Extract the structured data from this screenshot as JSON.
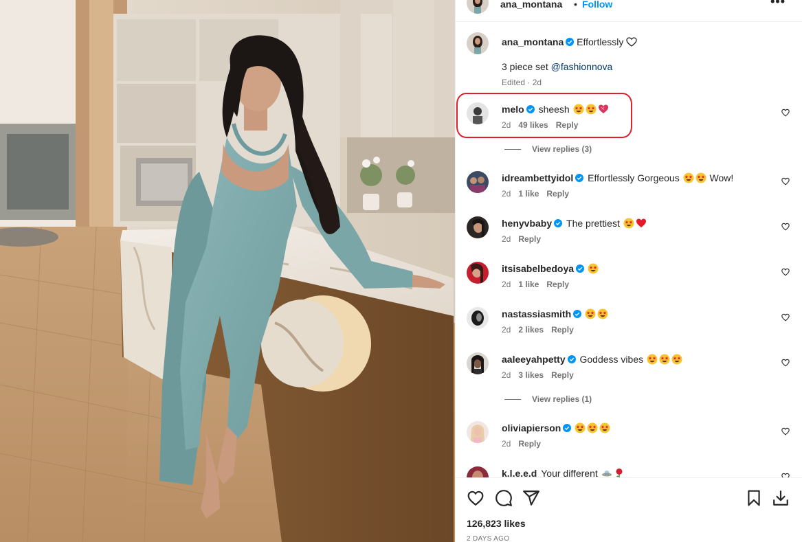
{
  "post": {
    "author": "ana_montana",
    "separator": "•",
    "follow_label": "Follow",
    "more_label": "•••",
    "caption_line1": "Effortlessly",
    "caption_line2_prefix": "3 piece set",
    "caption_mention": "@fashionnova",
    "caption_meta": "Edited · 2d",
    "likes": "126,823 likes",
    "date": "2 DAYS AGO"
  },
  "comments": [
    {
      "user": "melo",
      "verified": true,
      "text": "sheesh",
      "emojis": [
        "star-eyes",
        "star-eyes",
        "heart-love"
      ],
      "age": "2d",
      "likes": "49 likes",
      "reply": "Reply",
      "replies": "View replies (3)"
    },
    {
      "user": "idreambettyidol",
      "verified": true,
      "text": "Effortlessly Gorgeous",
      "emojis": [
        "star-eyes",
        "star-eyes"
      ],
      "text_after": "Wow!",
      "age": "2d",
      "likes": "1 like",
      "reply": "Reply"
    },
    {
      "user": "henyvbaby",
      "verified": true,
      "text": "The prettiest",
      "emojis": [
        "star-eyes",
        "heart"
      ],
      "age": "2d",
      "reply": "Reply"
    },
    {
      "user": "itsisabelbedoya",
      "verified": true,
      "text": "",
      "emojis": [
        "star-eyes"
      ],
      "age": "2d",
      "likes": "1 like",
      "reply": "Reply"
    },
    {
      "user": "nastassiasmith",
      "verified": true,
      "text": "",
      "emojis": [
        "star-eyes",
        "star-eyes"
      ],
      "age": "2d",
      "likes": "2 likes",
      "reply": "Reply"
    },
    {
      "user": "aaleeyahpetty",
      "verified": true,
      "text": "Goddess vibes",
      "emojis": [
        "star-eyes",
        "star-eyes",
        "star-eyes"
      ],
      "age": "2d",
      "likes": "3 likes",
      "reply": "Reply",
      "replies": "View replies (1)"
    },
    {
      "user": "oliviapierson",
      "verified": true,
      "text": "",
      "emojis": [
        "star-eyes",
        "star-eyes",
        "star-eyes"
      ],
      "age": "2d",
      "reply": "Reply"
    },
    {
      "user": "k.l.e.e.d",
      "verified": false,
      "text": "Your different",
      "emojis": [
        "ufo",
        "rose"
      ],
      "age": "",
      "reply": ""
    }
  ],
  "colors": {
    "verified": "#0095f6",
    "follow": "#0095f6",
    "highlight": "#e0202a",
    "muted": "#737373"
  },
  "icons": [
    "heart-icon",
    "comment-icon",
    "share-icon",
    "bookmark-icon",
    "download-icon",
    "verified-icon",
    "more-icon"
  ]
}
